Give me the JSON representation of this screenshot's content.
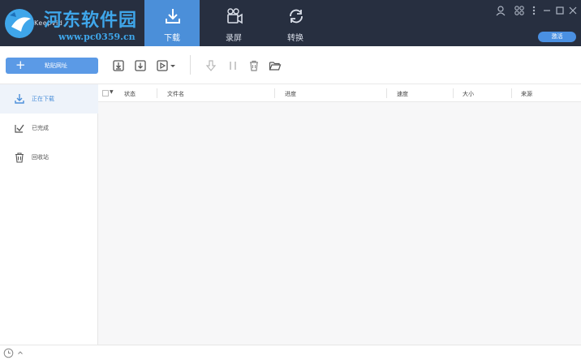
{
  "app": {
    "name": "Keepvid",
    "watermark_title": "河东软件园",
    "watermark_url": "www.pc0359.cn"
  },
  "nav_tabs": [
    {
      "label": "下载",
      "icon": "download-icon",
      "active": true
    },
    {
      "label": "录屏",
      "icon": "camera-icon",
      "active": false
    },
    {
      "label": "转换",
      "icon": "convert-icon",
      "active": false
    }
  ],
  "window": {
    "upgrade_label": "激活"
  },
  "toolbar": {
    "paste_label": "粘贴网址"
  },
  "sidebar": {
    "items": [
      {
        "label": "正在下载",
        "icon": "download-icon",
        "active": true
      },
      {
        "label": "已完成",
        "icon": "check-icon",
        "active": false
      },
      {
        "label": "回收站",
        "icon": "trash-icon",
        "active": false
      }
    ]
  },
  "table": {
    "columns": [
      "状态",
      "文件名",
      "进度",
      "速度",
      "大小",
      "来源"
    ]
  },
  "colors": {
    "titlebar": "#272f40",
    "accent": "#4b8fd9",
    "button": "#5b9ae6"
  }
}
